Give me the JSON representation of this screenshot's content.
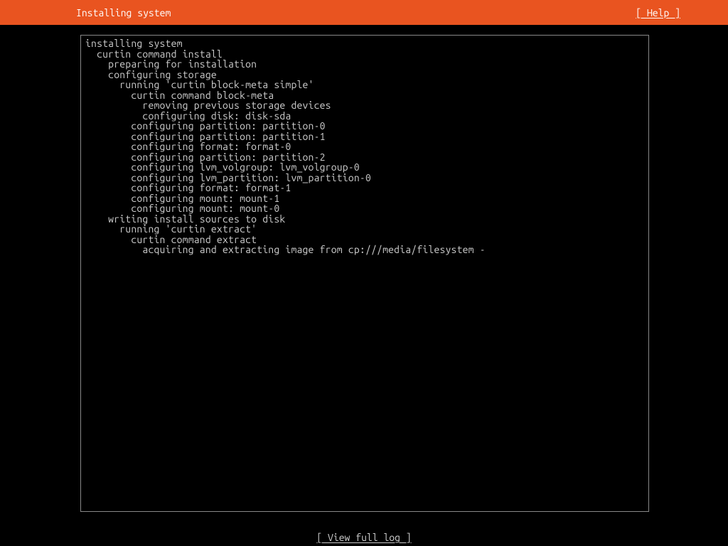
{
  "header": {
    "title": "Installing system",
    "help_label": "[ Help ]"
  },
  "log": {
    "lines": [
      {
        "indent": 0,
        "text": "installing system"
      },
      {
        "indent": 1,
        "text": "curtin command install"
      },
      {
        "indent": 2,
        "text": "preparing for installation"
      },
      {
        "indent": 2,
        "text": "configuring storage"
      },
      {
        "indent": 3,
        "text": "running 'curtin block-meta simple'"
      },
      {
        "indent": 4,
        "text": "curtin command block-meta"
      },
      {
        "indent": 5,
        "text": "removing previous storage devices"
      },
      {
        "indent": 5,
        "text": "configuring disk: disk-sda"
      },
      {
        "indent": 4,
        "text": "configuring partition: partition-0"
      },
      {
        "indent": 4,
        "text": "configuring partition: partition-1"
      },
      {
        "indent": 4,
        "text": "configuring format: format-0"
      },
      {
        "indent": 4,
        "text": "configuring partition: partition-2"
      },
      {
        "indent": 4,
        "text": "configuring lvm_volgroup: lvm_volgroup-0"
      },
      {
        "indent": 4,
        "text": "configuring lvm_partition: lvm_partition-0"
      },
      {
        "indent": 4,
        "text": "configuring format: format-1"
      },
      {
        "indent": 4,
        "text": "configuring mount: mount-1"
      },
      {
        "indent": 4,
        "text": "configuring mount: mount-0"
      },
      {
        "indent": 2,
        "text": "writing install sources to disk"
      },
      {
        "indent": 3,
        "text": "running 'curtin extract'"
      },
      {
        "indent": 4,
        "text": "curtin command extract"
      },
      {
        "indent": 5,
        "text": "acquiring and extracting image from cp:///media/filesystem -"
      }
    ]
  },
  "footer": {
    "view_full_log_label": "[ View full log ]"
  }
}
